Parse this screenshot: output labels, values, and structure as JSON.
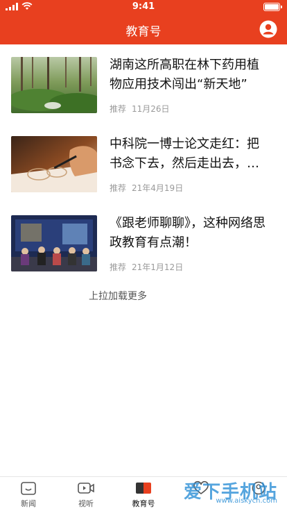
{
  "status": {
    "time": "9:41"
  },
  "nav": {
    "title": "教育号"
  },
  "articles": [
    {
      "title": "湖南这所高职在林下药用植物应用技术闯出“新天地”",
      "tag": "推荐",
      "date": "11月26日"
    },
    {
      "title": "中科院一博士论文走红：把书念下去，然后走出去，…",
      "tag": "推荐",
      "date": "21年4月19日"
    },
    {
      "title": "《跟老师聊聊》，这种网络思政教育有点潮！",
      "tag": "推荐",
      "date": "21年1月12日"
    }
  ],
  "load_more": "上拉加载更多",
  "tabs": [
    {
      "label": "新闻",
      "icon": "news-icon"
    },
    {
      "label": "视听",
      "icon": "video-icon"
    },
    {
      "label": "教育号",
      "icon": "education-icon"
    },
    {
      "label": "",
      "icon": "heart-icon"
    },
    {
      "label": "",
      "icon": "profile-icon"
    }
  ],
  "watermark": {
    "text": "爱下手机站",
    "url": "www.aiskycn.com"
  },
  "colors": {
    "brand": "#e8401f",
    "meta": "#9a9a9a",
    "title": "#111111"
  }
}
